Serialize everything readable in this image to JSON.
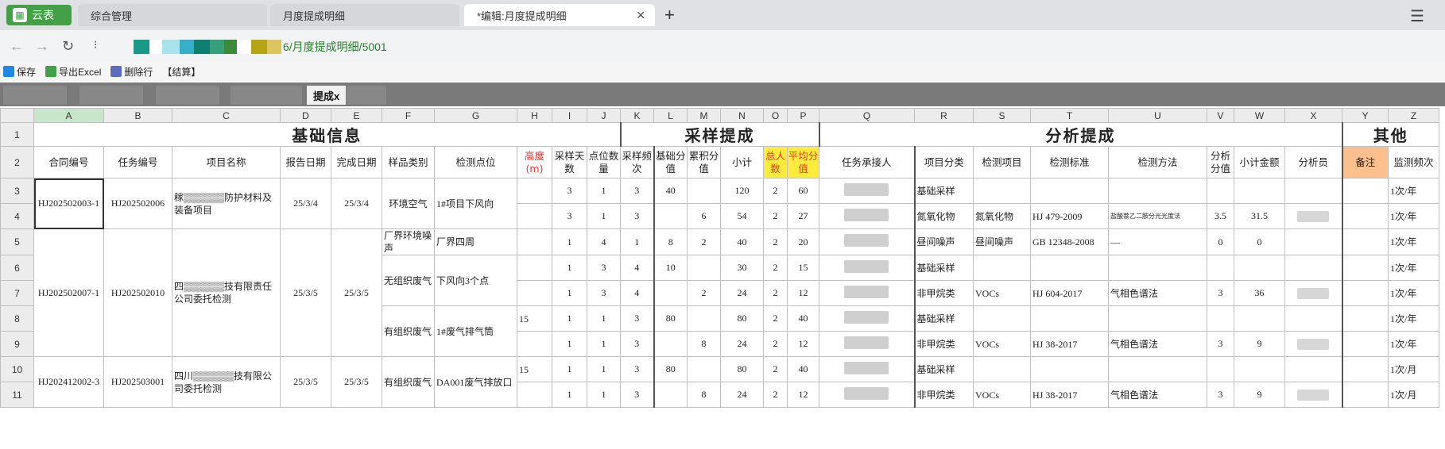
{
  "browser": {
    "app_name": "云表",
    "tabs": [
      {
        "label": "综合管理"
      },
      {
        "label": "月度提成明细"
      },
      {
        "label": "*编辑:月度提成明细"
      }
    ],
    "url_visible": "6/月度提成明细/5001"
  },
  "toolbar": {
    "save": "保存",
    "export": "导出Excel",
    "delete_row": "删除行",
    "bracket_item": "【结算】"
  },
  "inner_tabs": {
    "active": "提成x"
  },
  "sheet": {
    "columns": [
      "A",
      "B",
      "C",
      "D",
      "E",
      "F",
      "G",
      "H",
      "I",
      "J",
      "K",
      "L",
      "M",
      "N",
      "O",
      "P",
      "Q",
      "R",
      "S",
      "T",
      "U",
      "V",
      "W",
      "X",
      "Y",
      "Z"
    ],
    "selected_column": "A",
    "groups": {
      "basic": "基础信息",
      "sampling": "采样提成",
      "analysis": "分析提成",
      "other": "其他"
    },
    "headers": {
      "A": "合同编号",
      "B": "任务编号",
      "C": "项目名称",
      "D": "报告日期",
      "E": "完成日期",
      "F": "样品类别",
      "G": "检测点位",
      "H": "高度(m)",
      "I": "采样天数",
      "J": "点位数量",
      "K": "采样频次",
      "L": "基础分值",
      "M": "累积分值",
      "N": "小计",
      "O": "总人数",
      "P": "平均分值",
      "Q": "任务承接人",
      "R": "项目分类",
      "S": "检测项目",
      "T": "检测标准",
      "U": "检测方法",
      "V": "分析分值",
      "W": "小计金额",
      "X": "分析员",
      "Y": "备注",
      "Z": "监测频次"
    },
    "blocks": {
      "b1": {
        "contract": "HJ202502003-1",
        "task": "HJ202502006",
        "project": "稼▒▒▒▒▒▒防护材料及装备项目",
        "report_date": "25/3/4",
        "finish_date": "25/3/4"
      },
      "b2": {
        "contract": "HJ202502007-1",
        "task": "HJ202502010",
        "project": "四▒▒▒▒▒▒技有限责任公司委托检测",
        "report_date": "25/3/5",
        "finish_date": "25/3/5"
      },
      "b3": {
        "contract": "HJ202412002-3",
        "task": "HJ202503001",
        "project": "四川▒▒▒▒▒▒技有限公司委托检测",
        "report_date": "25/3/5",
        "finish_date": "25/3/5"
      }
    },
    "merged": {
      "f_air": "环境空气",
      "g_downwind": "1#项目下风向",
      "f_noise": "厂界环境噪声",
      "g_noise": "厂界四周",
      "f_unorg": "无组织废气",
      "g_unorg": "下风向3个点",
      "f_org1": "有组织废气",
      "g_org1": "1#废气排气筒",
      "f_org2": "有组织废气",
      "g_org2": "DA001废气排放口"
    },
    "rows": [
      {
        "n": "3",
        "H": "",
        "I": "3",
        "J": "1",
        "K": "3",
        "L": "40",
        "M": "",
        "N": "120",
        "O": "2",
        "P": "60",
        "R": "基础采样",
        "S": "",
        "T": "",
        "U": "",
        "V": "",
        "W": "",
        "Z": "1次/年"
      },
      {
        "n": "4",
        "H": "",
        "I": "3",
        "J": "1",
        "K": "3",
        "L": "",
        "M": "6",
        "N": "54",
        "O": "2",
        "P": "27",
        "R": "氮氧化物",
        "S": "氮氧化物",
        "T": "HJ 479-2009",
        "U": "盐酸萘乙二胺分光光度法",
        "V": "3.5",
        "W": "31.5",
        "Z": "1次/年"
      },
      {
        "n": "5",
        "H": "",
        "I": "1",
        "J": "4",
        "K": "1",
        "L": "8",
        "M": "2",
        "N": "40",
        "O": "2",
        "P": "20",
        "R": "昼间噪声",
        "S": "昼间噪声",
        "T": "GB 12348-2008",
        "U": "—",
        "V": "0",
        "W": "0",
        "Z": "1次/年"
      },
      {
        "n": "6",
        "H": "",
        "I": "1",
        "J": "3",
        "K": "4",
        "L": "10",
        "M": "",
        "N": "30",
        "O": "2",
        "P": "15",
        "R": "基础采样",
        "S": "",
        "T": "",
        "U": "",
        "V": "",
        "W": "",
        "Z": "1次/年"
      },
      {
        "n": "7",
        "H": "",
        "I": "1",
        "J": "3",
        "K": "4",
        "L": "",
        "M": "2",
        "N": "24",
        "O": "2",
        "P": "12",
        "R": "非甲烷类",
        "S": "VOCs",
        "T": "HJ 604-2017",
        "U": "气相色谱法",
        "V": "3",
        "W": "36",
        "Z": "1次/年"
      },
      {
        "n": "8",
        "H": "15",
        "I": "1",
        "J": "1",
        "K": "3",
        "L": "80",
        "M": "",
        "N": "80",
        "O": "2",
        "P": "40",
        "R": "基础采样",
        "S": "",
        "T": "",
        "U": "",
        "V": "",
        "W": "",
        "Z": "1次/年"
      },
      {
        "n": "9",
        "H": "",
        "I": "1",
        "J": "1",
        "K": "3",
        "L": "",
        "M": "8",
        "N": "24",
        "O": "2",
        "P": "12",
        "R": "非甲烷类",
        "S": "VOCs",
        "T": "HJ 38-2017",
        "U": "气相色谱法",
        "V": "3",
        "W": "9",
        "Z": "1次/年"
      },
      {
        "n": "10",
        "H": "15",
        "I": "1",
        "J": "1",
        "K": "3",
        "L": "80",
        "M": "",
        "N": "80",
        "O": "2",
        "P": "40",
        "R": "基础采样",
        "S": "",
        "T": "",
        "U": "",
        "V": "",
        "W": "",
        "Z": "1次/月"
      },
      {
        "n": "11",
        "H": "",
        "I": "1",
        "J": "1",
        "K": "3",
        "L": "",
        "M": "8",
        "N": "24",
        "O": "2",
        "P": "12",
        "R": "非甲烷类",
        "S": "VOCs",
        "T": "HJ 38-2017",
        "U": "气相色谱法",
        "V": "3",
        "W": "9",
        "Z": "1次/月"
      }
    ]
  },
  "colors": {
    "green": "#43a047",
    "yellow": "#ffeb3b",
    "orange": "#fbc08d",
    "red": "#e53935"
  }
}
